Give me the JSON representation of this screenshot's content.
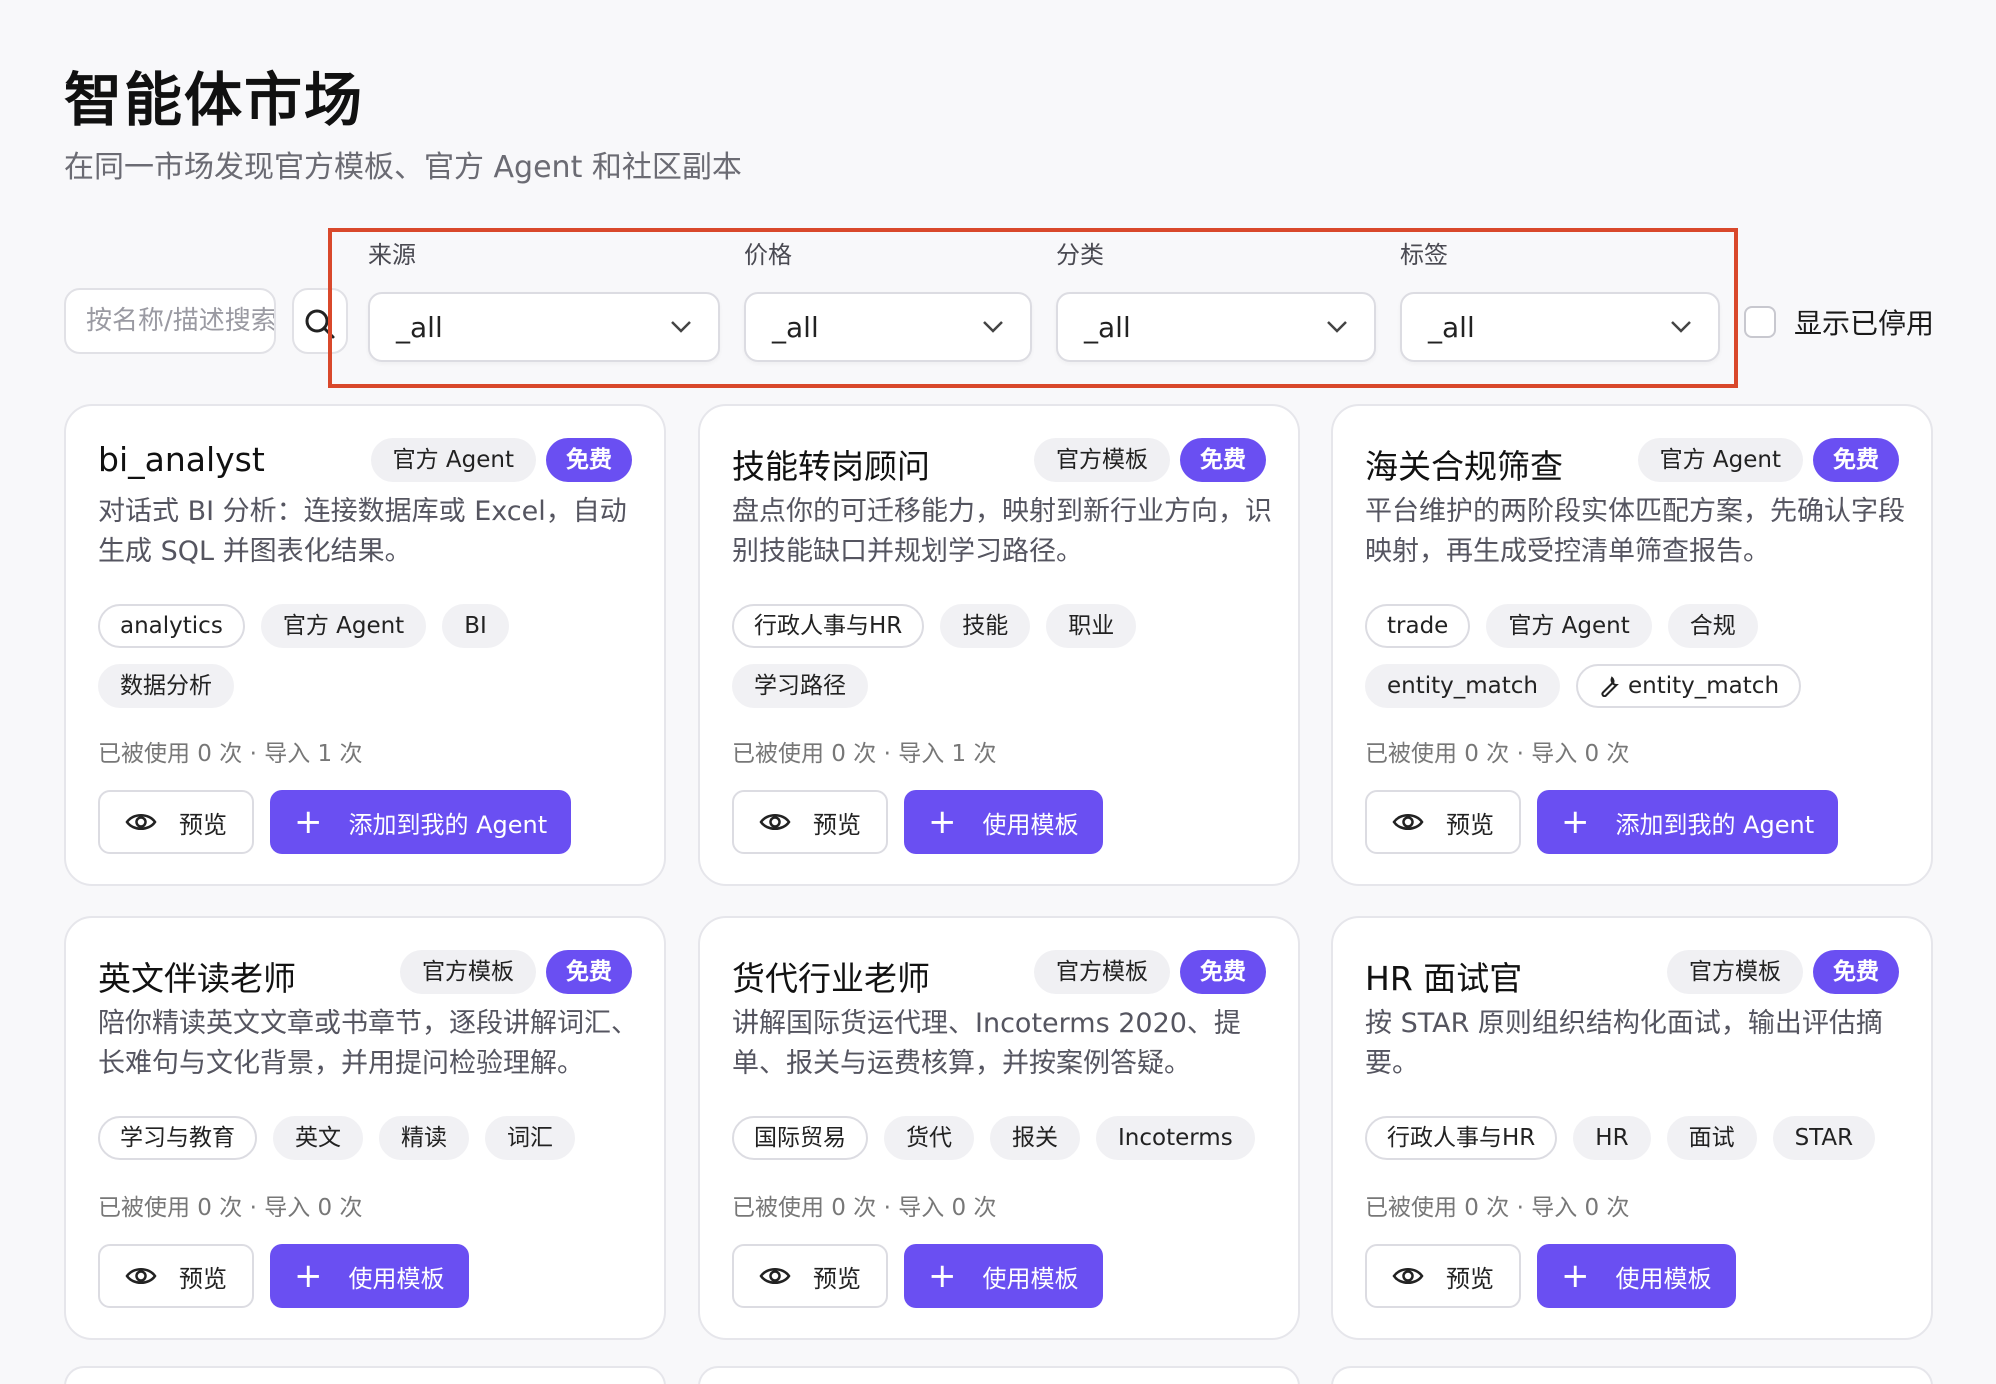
{
  "header": {
    "title": "智能体市场",
    "subtitle": "在同一市场发现官方模板、官方 Agent 和社区副本"
  },
  "search": {
    "placeholder": "按名称/描述搜索"
  },
  "filters": [
    {
      "label": "来源",
      "value": "_all"
    },
    {
      "label": "价格",
      "value": "_all"
    },
    {
      "label": "分类",
      "value": "_all"
    },
    {
      "label": "标签",
      "value": "_all"
    }
  ],
  "show_disabled": {
    "label": "显示已停用",
    "checked": false
  },
  "highlight_color": "#d9482b",
  "accent_color": "#6a4ff2",
  "cards": [
    {
      "name": "bi_analyst",
      "type": "官方 Agent",
      "price": "免费",
      "description": "对话式 BI 分析：连接数据库或 Excel，自动生成 SQL 并图表化结果。",
      "tags": [
        {
          "text": "analytics",
          "style": "outline"
        },
        {
          "text": "官方 Agent",
          "style": "filled"
        },
        {
          "text": "BI",
          "style": "filled"
        },
        {
          "text": "数据分析",
          "style": "filled"
        }
      ],
      "stats": "已被使用 0 次 · 导入 1 次",
      "preview_label": "预览",
      "action_label": "添加到我的 Agent"
    },
    {
      "name": "技能转岗顾问",
      "type": "官方模板",
      "price": "免费",
      "description": "盘点你的可迁移能力，映射到新行业方向，识别技能缺口并规划学习路径。",
      "tags": [
        {
          "text": "行政人事与HR",
          "style": "outline"
        },
        {
          "text": "技能",
          "style": "filled"
        },
        {
          "text": "职业",
          "style": "filled"
        },
        {
          "text": "学习路径",
          "style": "filled"
        }
      ],
      "stats": "已被使用 0 次 · 导入 1 次",
      "preview_label": "预览",
      "action_label": "使用模板"
    },
    {
      "name": "海关合规筛查",
      "type": "官方 Agent",
      "price": "免费",
      "description": "平台维护的两阶段实体匹配方案，先确认字段映射，再生成受控清单筛查报告。",
      "tags": [
        {
          "text": "trade",
          "style": "outline"
        },
        {
          "text": "官方 Agent",
          "style": "filled"
        },
        {
          "text": "合规",
          "style": "filled"
        },
        {
          "text": "entity_match",
          "style": "filled"
        },
        {
          "text": "entity_match",
          "style": "outline",
          "icon": "wrench-icon"
        }
      ],
      "stats": "已被使用 0 次 · 导入 0 次",
      "preview_label": "预览",
      "action_label": "添加到我的 Agent"
    },
    {
      "name": "英文伴读老师",
      "type": "官方模板",
      "price": "免费",
      "description": "陪你精读英文文章或书章节，逐段讲解词汇、长难句与文化背景，并用提问检验理解。",
      "tags": [
        {
          "text": "学习与教育",
          "style": "outline"
        },
        {
          "text": "英文",
          "style": "filled"
        },
        {
          "text": "精读",
          "style": "filled"
        },
        {
          "text": "词汇",
          "style": "filled"
        }
      ],
      "stats": "已被使用 0 次 · 导入 0 次",
      "preview_label": "预览",
      "action_label": "使用模板"
    },
    {
      "name": "货代行业老师",
      "type": "官方模板",
      "price": "免费",
      "description": "讲解国际货运代理、Incoterms 2020、提单、报关与运费核算，并按案例答疑。",
      "tags": [
        {
          "text": "国际贸易",
          "style": "outline"
        },
        {
          "text": "货代",
          "style": "filled"
        },
        {
          "text": "报关",
          "style": "filled"
        },
        {
          "text": "Incoterms",
          "style": "filled"
        }
      ],
      "stats": "已被使用 0 次 · 导入 0 次",
      "preview_label": "预览",
      "action_label": "使用模板"
    },
    {
      "name": "HR 面试官",
      "type": "官方模板",
      "price": "免费",
      "description": "按 STAR 原则组织结构化面试，输出评估摘要。",
      "tags": [
        {
          "text": "行政人事与HR",
          "style": "outline"
        },
        {
          "text": "HR",
          "style": "filled"
        },
        {
          "text": "面试",
          "style": "filled"
        },
        {
          "text": "STAR",
          "style": "filled"
        }
      ],
      "stats": "已被使用 0 次 · 导入 0 次",
      "preview_label": "预览",
      "action_label": "使用模板"
    }
  ]
}
